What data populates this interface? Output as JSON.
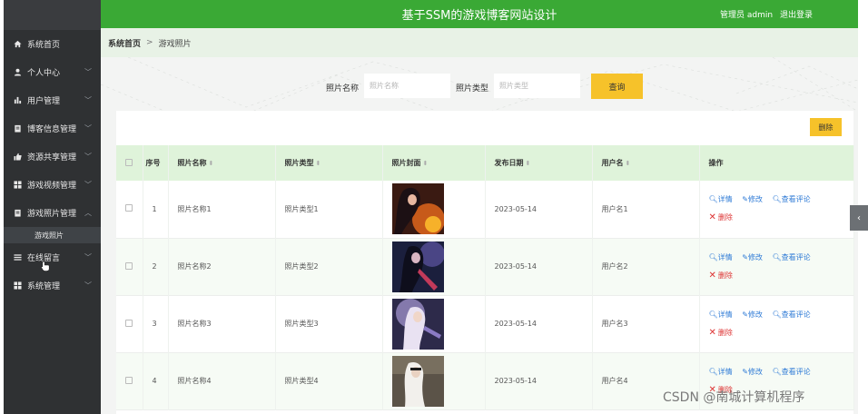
{
  "header": {
    "title": "基于SSM的游戏博客网站设计",
    "user_text": "管理员 admin",
    "logout_label": "退出登录"
  },
  "sidebar": {
    "items": [
      {
        "label": "系统首页",
        "icon": "home-icon",
        "has_chevron": false
      },
      {
        "label": "个人中心",
        "icon": "user-icon",
        "has_chevron": true
      },
      {
        "label": "用户管理",
        "icon": "bar-chart-icon",
        "has_chevron": true
      },
      {
        "label": "博客信息管理",
        "icon": "document-icon",
        "has_chevron": true
      },
      {
        "label": "资源共享管理",
        "icon": "thumbs-up-icon",
        "has_chevron": true
      },
      {
        "label": "游戏视频管理",
        "icon": "grid-icon",
        "has_chevron": true
      },
      {
        "label": "游戏照片管理",
        "icon": "document-icon",
        "has_chevron": true,
        "expanded": true
      },
      {
        "label": "在线留言",
        "icon": "list-icon",
        "has_chevron": true
      },
      {
        "label": "系统管理",
        "icon": "grid-icon",
        "has_chevron": true
      }
    ],
    "submenu_label": "游戏照片"
  },
  "breadcrumb": {
    "home": "系统首页",
    "separator": ">",
    "current": "游戏照片"
  },
  "search": {
    "name_label": "照片名称",
    "name_placeholder": "照片名称",
    "type_label": "照片类型",
    "type_placeholder": "照片类型",
    "query_label": "查询"
  },
  "toolbar": {
    "delete_label": "删除"
  },
  "table": {
    "columns": [
      "序号",
      "照片名称",
      "照片类型",
      "照片封面",
      "发布日期",
      "用户名",
      "操作"
    ],
    "rows": [
      {
        "index": "1",
        "name": "照片名称1",
        "type": "照片类型1",
        "date": "2023-05-14",
        "user": "用户名1"
      },
      {
        "index": "2",
        "name": "照片名称2",
        "type": "照片类型2",
        "date": "2023-05-14",
        "user": "用户名2"
      },
      {
        "index": "3",
        "name": "照片名称3",
        "type": "照片类型3",
        "date": "2023-05-14",
        "user": "用户名3"
      },
      {
        "index": "4",
        "name": "照片名称4",
        "type": "照片类型4",
        "date": "2023-05-14",
        "user": "用户名4"
      }
    ],
    "actions": {
      "detail": "详情",
      "edit": "修改",
      "comments": "查看评论",
      "delete": "删除"
    }
  },
  "watermark": "CSDN @南城计算机程序",
  "colors": {
    "header_green": "#3aa935",
    "sidebar_dark": "#2f3133",
    "accent_yellow": "#f6c22a",
    "link_blue": "#2f7bd6",
    "delete_red": "#d33333"
  }
}
